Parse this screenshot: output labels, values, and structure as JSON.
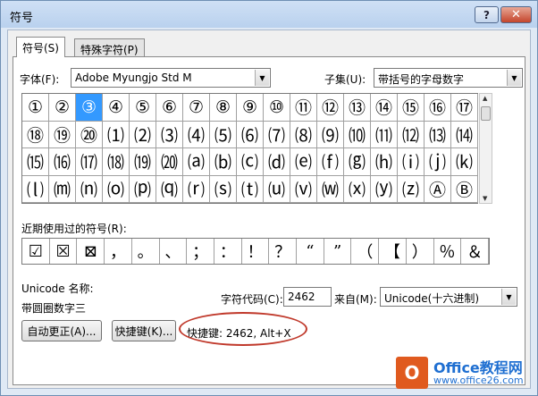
{
  "window": {
    "title": "符号",
    "help_glyph": "?",
    "close_glyph": "✕"
  },
  "tabs": [
    {
      "label": "符号(S)",
      "active": true
    },
    {
      "label": "特殊字符(P)",
      "active": false
    }
  ],
  "font": {
    "label": "字体(F):",
    "value": "Adobe Myungjo Std M"
  },
  "subset": {
    "label": "子集(U):",
    "value": "带括号的字母数字"
  },
  "symbols": {
    "selected_index": 2,
    "cells": [
      "①",
      "②",
      "③",
      "④",
      "⑤",
      "⑥",
      "⑦",
      "⑧",
      "⑨",
      "⑩",
      "⑪",
      "⑫",
      "⑬",
      "⑭",
      "⑮",
      "⑯",
      "⑰",
      "⑱",
      "⑲",
      "⑳",
      "⑴",
      "⑵",
      "⑶",
      "⑷",
      "⑸",
      "⑹",
      "⑺",
      "⑻",
      "⑼",
      "⑽",
      "⑾",
      "⑿",
      "⒀",
      "⒁",
      "⒂",
      "⒃",
      "⒄",
      "⒅",
      "⒆",
      "⒇",
      "⒜",
      "⒝",
      "⒞",
      "⒟",
      "⒠",
      "⒡",
      "⒢",
      "⒣",
      "⒤",
      "⒥",
      "⒦",
      "⒧",
      "⒨",
      "⒩",
      "⒪",
      "⒫",
      "⒬",
      "⒭",
      "⒮",
      "⒯",
      "⒰",
      "⒱",
      "⒲",
      "⒳",
      "⒴",
      "⒵",
      "Ⓐ",
      "Ⓑ"
    ]
  },
  "recent": {
    "label": "近期使用过的符号(R):",
    "cells": [
      "☑",
      "☒",
      "⊠",
      "，",
      "。",
      "、",
      "；",
      "：",
      "！",
      "？",
      "“",
      "”",
      "（",
      "【",
      "）",
      "％",
      "＆"
    ]
  },
  "unicode": {
    "name_label": "Unicode 名称:",
    "name_value": "带圆圈数字三",
    "code_label": "字符代码(C):",
    "code_value": "2462",
    "from_label": "来自(M):",
    "from_value": "Unicode(十六进制)"
  },
  "buttons": {
    "autocorrect": "自动更正(A)...",
    "shortcut_key": "快捷键(K)...",
    "shortcut_text": "快捷键: 2462, Alt+X"
  },
  "watermark": {
    "logo": "O",
    "name": "Office教程网",
    "url": "www.office26.com"
  }
}
